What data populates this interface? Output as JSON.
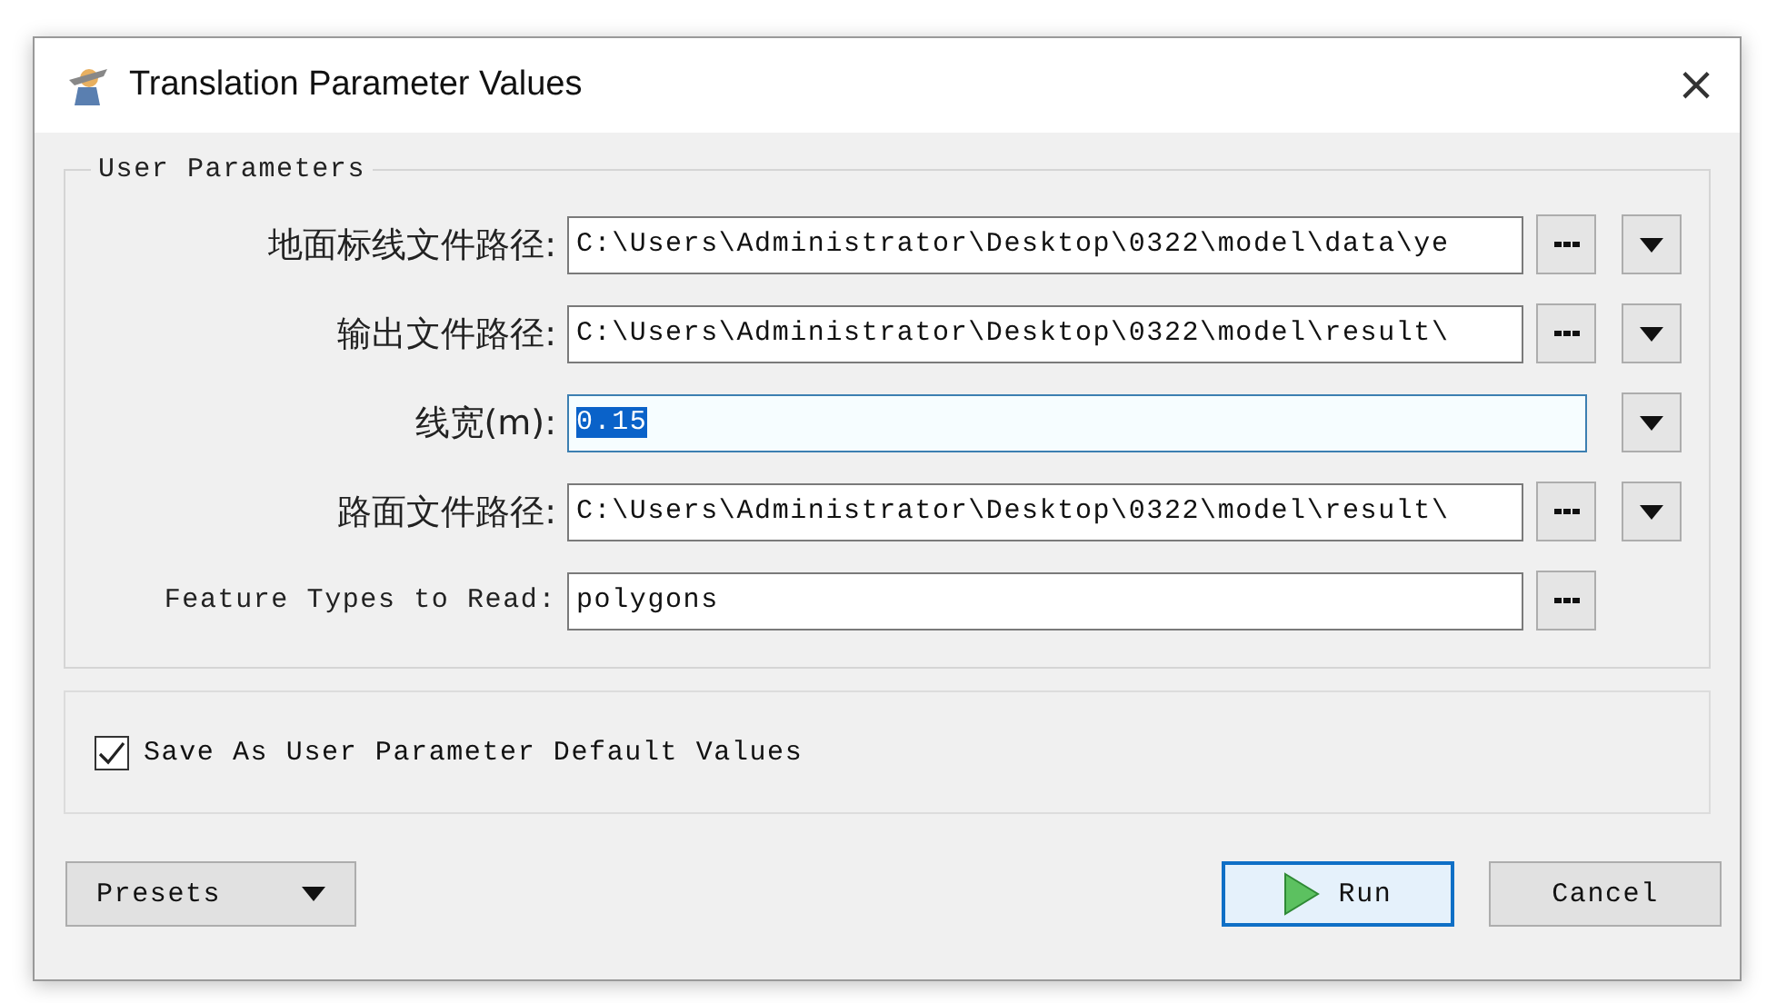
{
  "window": {
    "title": "Translation Parameter Values",
    "close": "×"
  },
  "group": {
    "title": "User Parameters"
  },
  "parameters": [
    {
      "label": "地面标线文件路径:",
      "value": "C:\\Users\\Administrator\\Desktop\\0322\\model\\data\\ye",
      "focused": false,
      "browse": true,
      "dropdown": true
    },
    {
      "label": "输出文件路径:",
      "value": "C:\\Users\\Administrator\\Desktop\\0322\\model\\result\\",
      "focused": false,
      "browse": true,
      "dropdown": true
    },
    {
      "label": "线宽(m):",
      "value": "0.15",
      "focused": true,
      "browse": false,
      "dropdown": true
    },
    {
      "label": "路面文件路径:",
      "value": "C:\\Users\\Administrator\\Desktop\\0322\\model\\result\\",
      "focused": false,
      "browse": true,
      "dropdown": true
    },
    {
      "label": "Feature Types to Read:",
      "value": "polygons",
      "focused": false,
      "browse": true,
      "dropdown": false
    }
  ],
  "save_default": {
    "label": "Save As User Parameter Default Values",
    "checked": true
  },
  "buttons": [
    {
      "kind": "menu",
      "label": "Presets",
      "default": false
    },
    {
      "kind": "run",
      "label": "Run",
      "default": true
    },
    {
      "kind": "plain",
      "label": "Cancel",
      "default": false
    }
  ]
}
